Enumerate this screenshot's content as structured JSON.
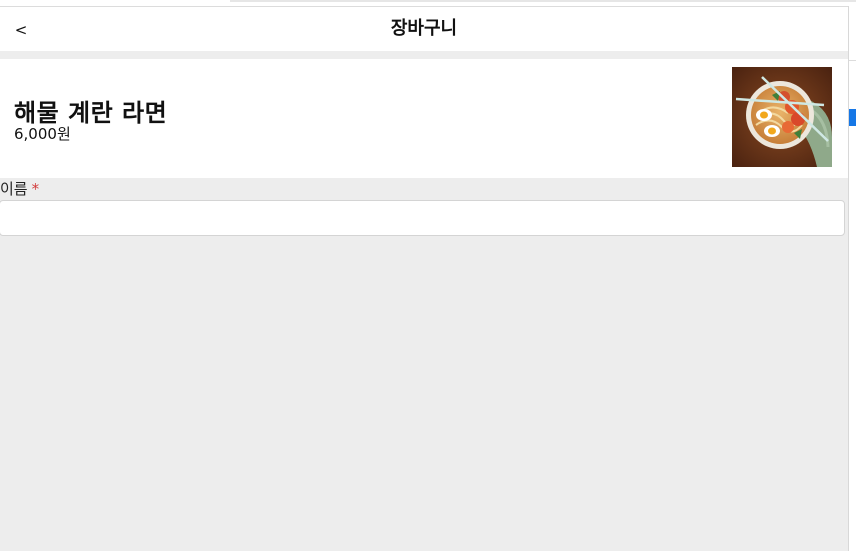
{
  "header": {
    "back_label": "<",
    "title": "장바구니"
  },
  "product": {
    "name": "해물 계란 라면",
    "price": "6,000원",
    "image_icon": "ramen-bowl-photo"
  },
  "form": {
    "name_label": "이름",
    "required_mark": "*",
    "name_value": ""
  },
  "colors": {
    "background": "#ededed",
    "card": "#ffffff",
    "required": "#d23b3b",
    "accent": "#1677e6"
  }
}
